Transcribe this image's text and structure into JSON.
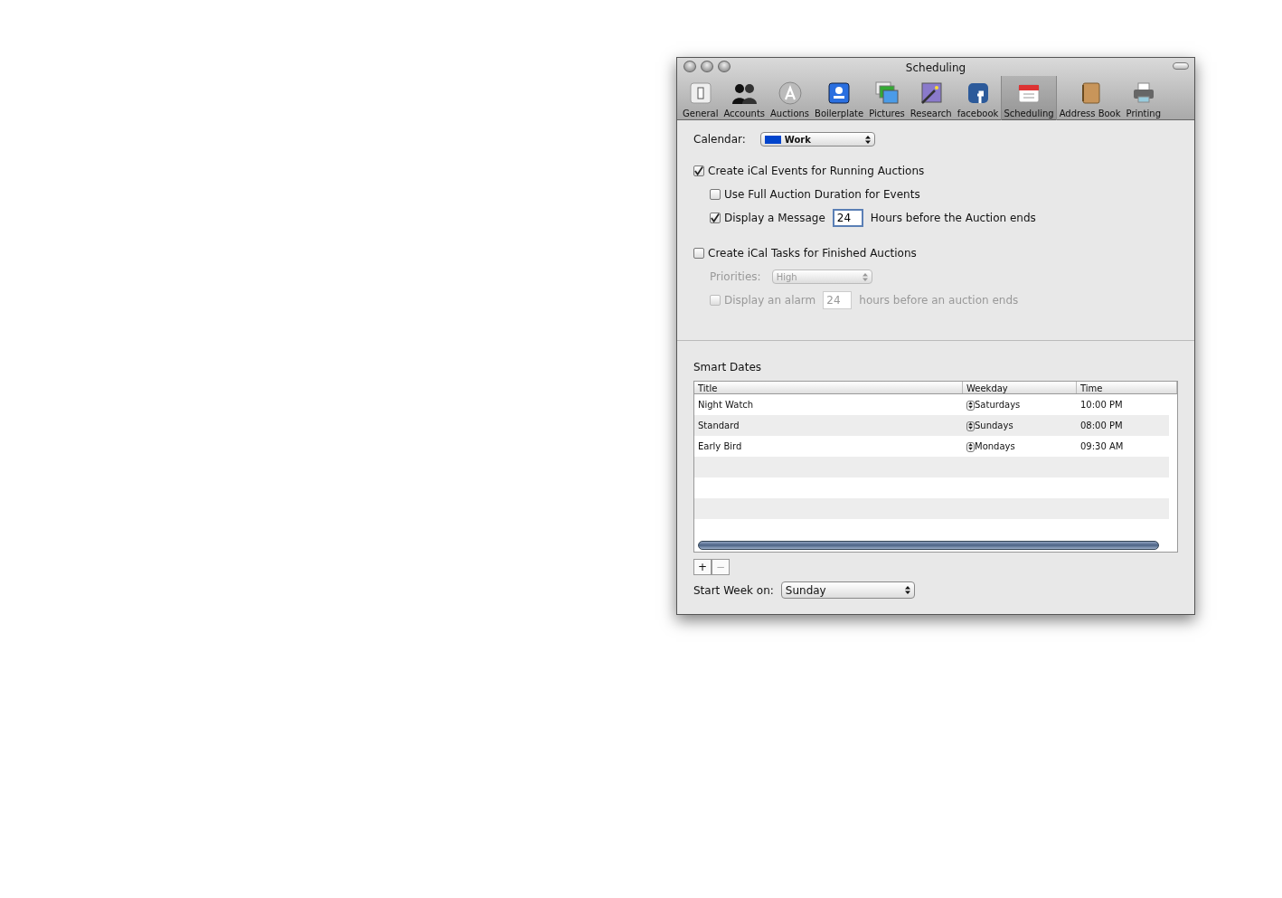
{
  "window": {
    "title": "Scheduling"
  },
  "toolbar": [
    {
      "label": "General",
      "selected": false
    },
    {
      "label": "Accounts",
      "selected": false
    },
    {
      "label": "Auctions",
      "selected": false
    },
    {
      "label": "Boilerplate",
      "selected": false
    },
    {
      "label": "Pictures",
      "selected": false
    },
    {
      "label": "Research",
      "selected": false
    },
    {
      "label": "facebook",
      "selected": false
    },
    {
      "label": "Scheduling",
      "selected": true
    },
    {
      "label": "Address Book",
      "selected": false
    },
    {
      "label": "Printing",
      "selected": false
    }
  ],
  "calendar": {
    "label": "Calendar:",
    "value": "Work",
    "color": "#0044cc"
  },
  "events": {
    "label": "Create iCal Events for Running Auctions",
    "checked": true,
    "options": [
      {
        "kind": "checkbox",
        "label": "Use Full Auction Duration for Events",
        "checked": false
      },
      {
        "kind": "hours",
        "label": "Display a Message",
        "checked": true,
        "value": "24",
        "suffix": "Hours before the Auction ends"
      }
    ]
  },
  "tasks": {
    "label": "Create iCal Tasks for Finished Auctions",
    "checked": false,
    "options": [
      {
        "kind": "select",
        "label": "Priorities:",
        "value": "High",
        "disabled": true
      },
      {
        "kind": "hours",
        "label": "Display an alarm",
        "checked": false,
        "value": "24",
        "suffix": "hours before an auction ends",
        "disabled": true
      }
    ]
  },
  "smart_dates": {
    "title": "Smart Dates",
    "columns": [
      "Title",
      "Weekday",
      "Time"
    ],
    "rows": [
      {
        "title": "Night Watch",
        "weekday": "Saturdays",
        "time": "10:00 PM"
      },
      {
        "title": "Standard",
        "weekday": "Sundays",
        "time": "08:00 PM"
      },
      {
        "title": "Early Bird",
        "weekday": "Mondays",
        "time": "09:30 AM"
      }
    ],
    "add_button": {
      "label": "+"
    },
    "remove_button": {
      "label": "−",
      "disabled": true
    }
  },
  "start_week": {
    "label": "Start Week on:",
    "value": "Sunday"
  }
}
